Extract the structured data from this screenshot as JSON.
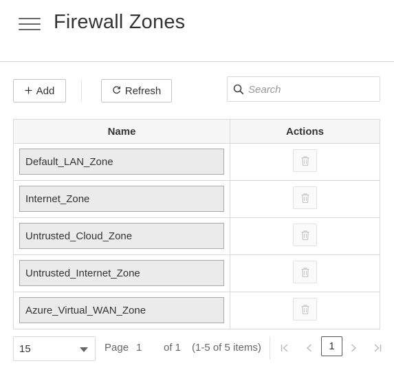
{
  "header": {
    "title": "Firewall Zones",
    "menu_icon": "hamburger-menu-icon"
  },
  "toolbar": {
    "add_label": "Add",
    "add_icon": "plus-icon",
    "refresh_label": "Refresh",
    "refresh_icon": "refresh-icon",
    "search_placeholder": "Search",
    "search_value": "",
    "search_icon": "search-icon"
  },
  "grid": {
    "columns": [
      "Name",
      "Actions"
    ],
    "rows": [
      {
        "name": "Default_LAN_Zone"
      },
      {
        "name": "Internet_Zone"
      },
      {
        "name": "Untrusted_Cloud_Zone"
      },
      {
        "name": "Untrusted_Internet_Zone"
      },
      {
        "name": "Azure_Virtual_WAN_Zone"
      }
    ],
    "row_action_icon": "trash-icon"
  },
  "pager": {
    "page_size": "15",
    "page_label": "Page",
    "page_value": "1",
    "of_label": "of 1",
    "items_info": "(1-5 of 5 items)",
    "current_page": "1",
    "nav_icons": [
      "first-page-icon",
      "previous-page-icon",
      "next-page-icon",
      "last-page-icon"
    ]
  },
  "colors": {
    "text": "#333333",
    "border": "#d9d9d9",
    "header_bg": "#f7f7f7",
    "field_bg": "#ebebeb",
    "disabled_icon": "#c8c8c8"
  }
}
